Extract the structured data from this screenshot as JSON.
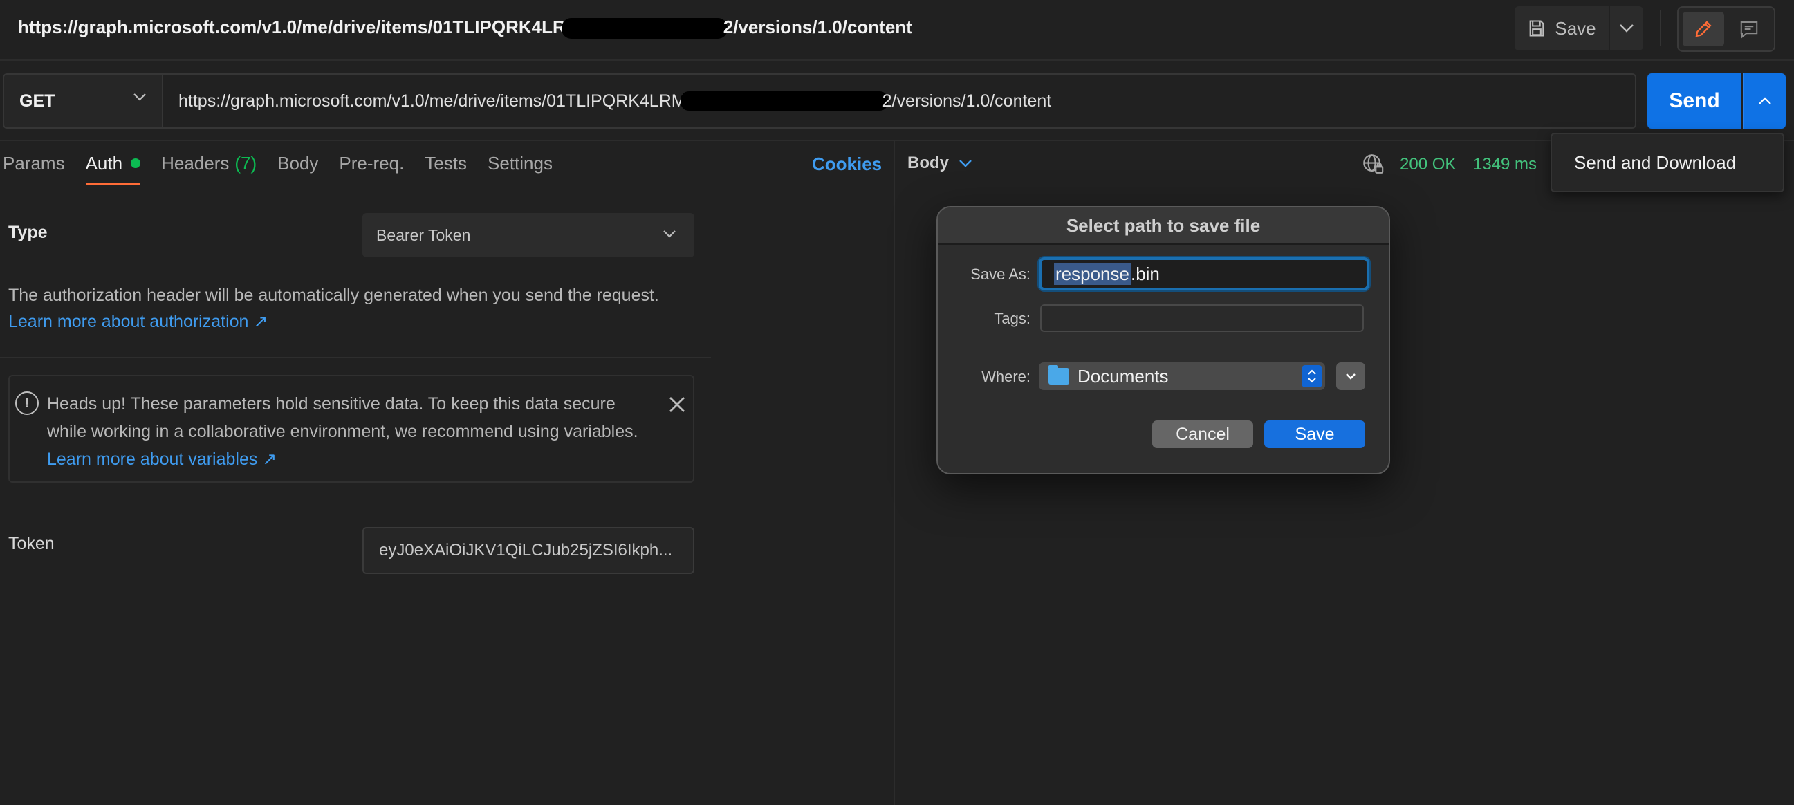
{
  "titlebar": {
    "title_prefix": "https://graph.microsoft.com/v1.0/me/drive/items/01TLIPQRK4LR",
    "title_suffix": "2/versions/1.0/content",
    "save_label": "Save"
  },
  "request": {
    "method": "GET",
    "url_prefix": "https://graph.microsoft.com/v1.0/me/drive/items/01TLIPQRK4LRM",
    "url_suffix": "2/versions/1.0/content",
    "send_label": "Send"
  },
  "send_menu": {
    "item": "Send and Download"
  },
  "tabs": {
    "params": "Params",
    "auth": "Auth",
    "headers": "Headers",
    "headers_count": "(7)",
    "body": "Body",
    "prereq": "Pre-req.",
    "tests": "Tests",
    "settings": "Settings",
    "cookies": "Cookies"
  },
  "auth": {
    "type_label": "Type",
    "type_value": "Bearer Token",
    "description": "The authorization header will be automatically generated when you send the request.",
    "learn_more": "Learn more about authorization ↗",
    "alert_text": "Heads up! These parameters hold sensitive data. To keep this data secure while working in a collaborative environment, we recommend using variables.",
    "alert_link": "Learn more about variables ↗",
    "token_label": "Token",
    "token_value": "eyJ0eXAiOiJKV1QiLCJub25jZSI6Ikph..."
  },
  "response": {
    "body_label": "Body",
    "status": "200 OK",
    "time": "1349 ms"
  },
  "dialog": {
    "title": "Select path to save file",
    "save_as_label": "Save As:",
    "filename_selected": "response",
    "filename_ext": ".bin",
    "tags_label": "Tags:",
    "tags_value": "",
    "where_label": "Where:",
    "where_value": "Documents",
    "cancel_label": "Cancel",
    "save_label": "Save"
  },
  "colors": {
    "accent_orange": "#ff6c37",
    "send_blue": "#0f72e5",
    "link_blue": "#3f9cf0",
    "success_green": "#0cbb52"
  }
}
